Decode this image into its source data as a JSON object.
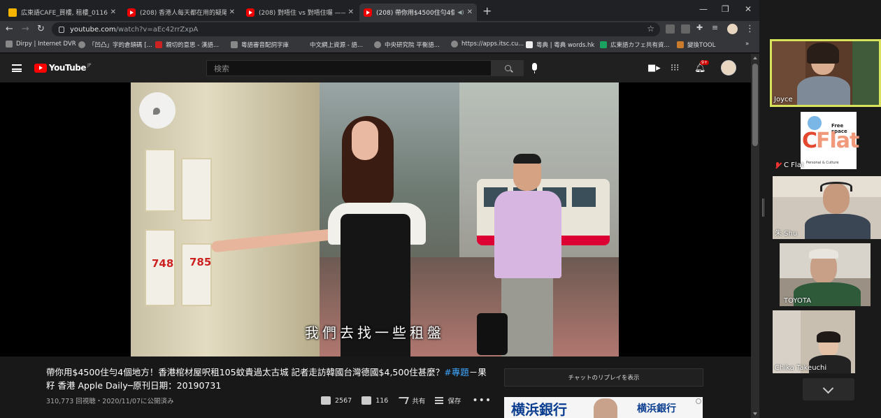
{
  "browser": {
    "tabs": [
      {
        "title": "広東語CAFE_買樓, 租樓_0116.ppt",
        "icon": "slides-icon"
      },
      {
        "title": "(208) 香港人每天都在用的疑尾助詞",
        "icon": "youtube-icon"
      },
      {
        "title": "(208) 對唔住 vs 對唔住囉 —— 寫",
        "icon": "youtube-icon"
      },
      {
        "title": "(208) 帶你用$4500住勻4個地",
        "icon": "youtube-icon"
      }
    ],
    "url_host": "youtube.com",
    "url_path": "/watch?v=aEc42rrZxpA",
    "bookmarks": [
      "Dirpy | Internet DVR",
      "「凹凸」字的倉頡碼 [...",
      "親切的意思 - 漢語...",
      "粵語審音配詞字庫",
      "中文網上資源 - 語...",
      "中央研究院 平衡語...",
      "https://apps.itsc.cu...",
      "粵典 | 粵典 words.hk",
      "広東語カフェ共有資...",
      "變換TOOL"
    ]
  },
  "youtube": {
    "logo_text": "YouTube",
    "logo_region": "JP",
    "search_placeholder": "検索",
    "notification_count": "9+",
    "subtitle": "我們去找一些租盤",
    "video_sign_price_1": "748",
    "video_sign_price_2": "785",
    "title_main": "帶你用$4500住勻4個地方！香港棺材屋呎租105蚊貴過太古城 記者走訪韓國台灣德國$4,500住甚麼？",
    "title_tag": "#專題",
    "title_tail": "－果籽 香港 Apple Daily─原刊日期：20190731",
    "meta": "310,773 回視聴・2020/11/07に公開済み",
    "likes": "2567",
    "dislikes": "116",
    "share_label": "共有",
    "save_label": "保存",
    "chat_replay": "チャットのリプレイを表示",
    "ad_text_1": "横浜銀行",
    "ad_text_2": "横浜銀行"
  },
  "zoom": {
    "participants": [
      {
        "name": "Joyce",
        "active": true
      },
      {
        "name": "C Flat",
        "muted": true
      },
      {
        "name": "朱 Shu"
      },
      {
        "name": "TOYOTA"
      },
      {
        "name": "Chika Takeuchi"
      }
    ],
    "cflat_logo": {
      "brand": "CFlat",
      "tagline": "Free space",
      "sub": "Personal & Culture"
    }
  },
  "colors": {
    "youtube_red": "#ff0000",
    "active_speaker": "#d7e35a",
    "link_blue": "#3ea6ff"
  }
}
